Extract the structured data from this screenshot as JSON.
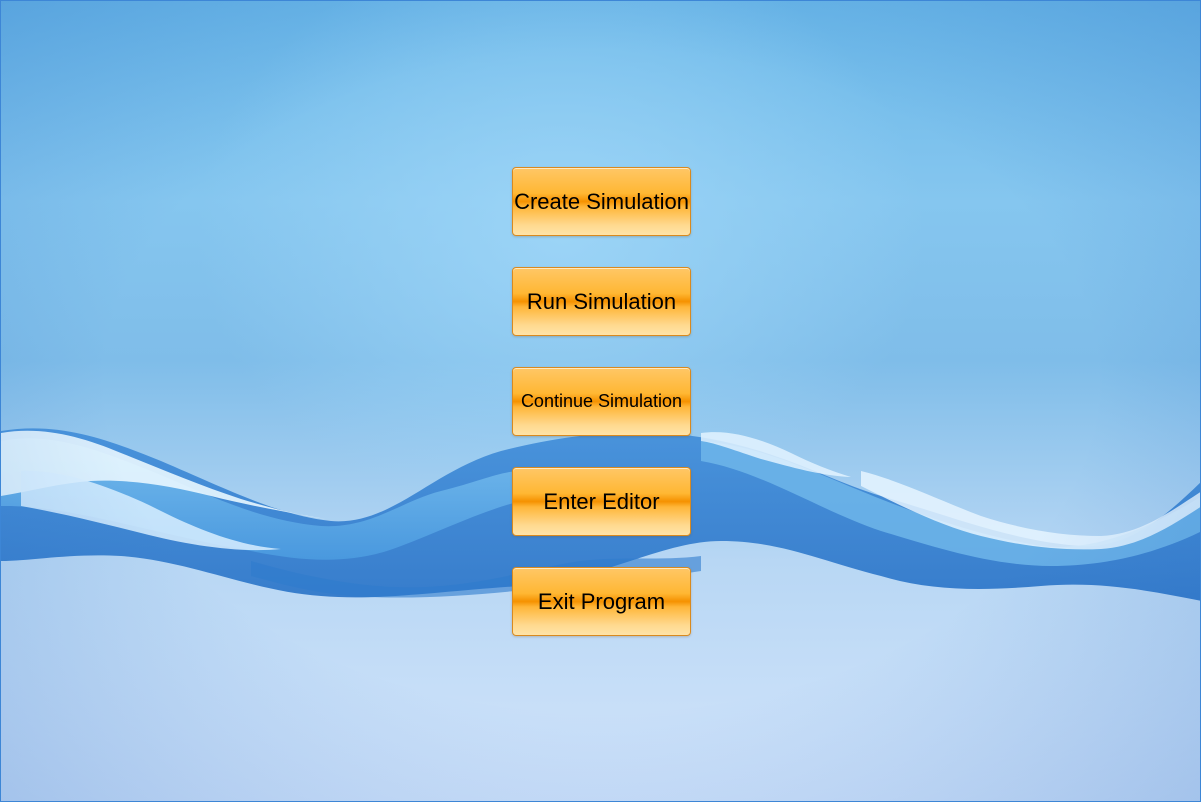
{
  "window": {
    "background_colors": [
      "#6ab7e8",
      "#85c6ef",
      "#d2e4fb"
    ],
    "wave_colors": [
      "#2f7fd0",
      "#5aa7e6",
      "#e8f6ff"
    ]
  },
  "menu": {
    "button_color": "#ffb733",
    "buttons": [
      {
        "id": "create",
        "label": "Create Simulation"
      },
      {
        "id": "run",
        "label": "Run Simulation"
      },
      {
        "id": "continue",
        "label": "Continue Simulation"
      },
      {
        "id": "editor",
        "label": "Enter Editor"
      },
      {
        "id": "exit",
        "label": "Exit Program"
      }
    ]
  }
}
